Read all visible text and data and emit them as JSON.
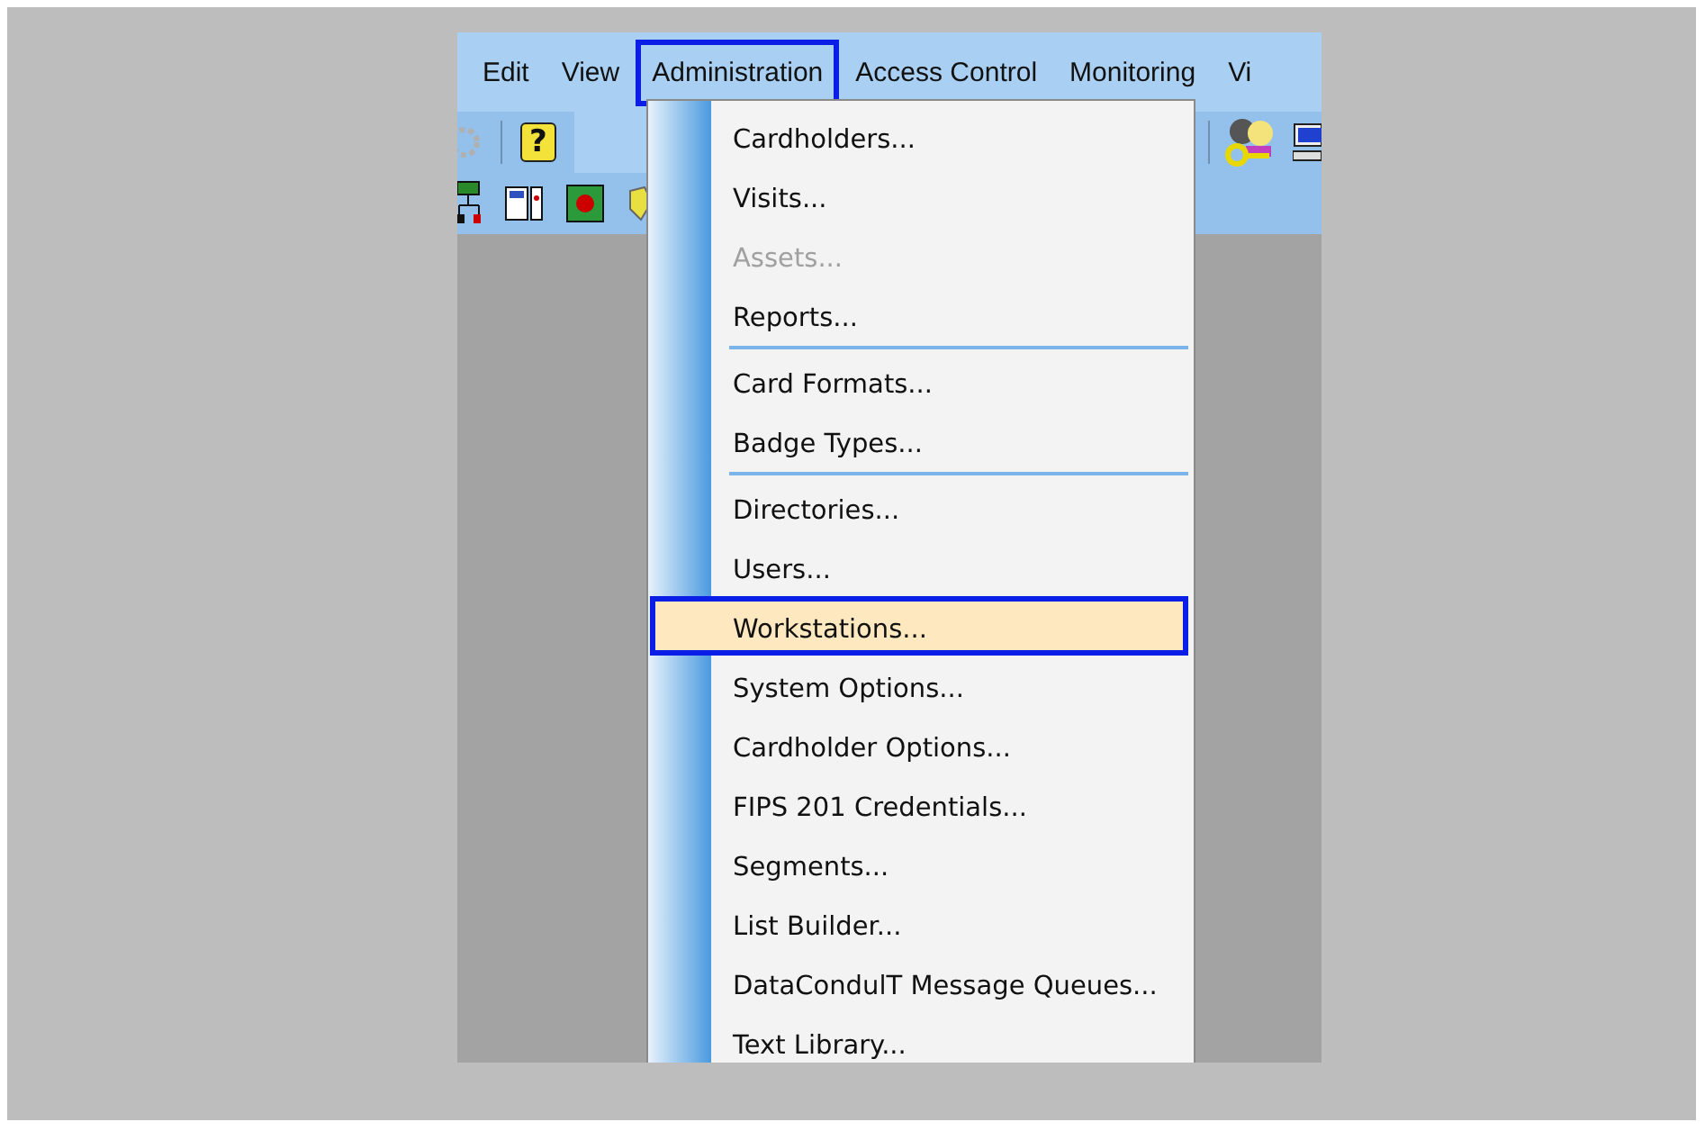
{
  "menu_bar": [
    {
      "label": "Edit",
      "selected": false
    },
    {
      "label": "View",
      "selected": false
    },
    {
      "label": "Administration",
      "selected": true
    },
    {
      "label": "Access Control",
      "selected": false
    },
    {
      "label": "Monitoring",
      "selected": false
    },
    {
      "label": "Vi",
      "selected": false
    }
  ],
  "administration_menu": [
    {
      "label": "Cardholders...",
      "disabled": false,
      "selected": false,
      "separator_after": false
    },
    {
      "label": "Visits...",
      "disabled": false,
      "selected": false,
      "separator_after": false
    },
    {
      "label": "Assets...",
      "disabled": true,
      "selected": false,
      "separator_after": false
    },
    {
      "label": "Reports...",
      "disabled": false,
      "selected": false,
      "separator_after": true
    },
    {
      "label": "Card Formats...",
      "disabled": false,
      "selected": false,
      "separator_after": false
    },
    {
      "label": "Badge Types...",
      "disabled": false,
      "selected": false,
      "separator_after": true
    },
    {
      "label": "Directories...",
      "disabled": false,
      "selected": false,
      "separator_after": false
    },
    {
      "label": "Users...",
      "disabled": false,
      "selected": false,
      "separator_after": false
    },
    {
      "label": "Workstations...",
      "disabled": false,
      "selected": true,
      "separator_after": false
    },
    {
      "label": "System Options...",
      "disabled": false,
      "selected": false,
      "separator_after": false
    },
    {
      "label": "Cardholder Options...",
      "disabled": false,
      "selected": false,
      "separator_after": false
    },
    {
      "label": "FIPS 201 Credentials...",
      "disabled": false,
      "selected": false,
      "separator_after": false
    },
    {
      "label": "Segments...",
      "disabled": false,
      "selected": false,
      "separator_after": false
    },
    {
      "label": "List Builder...",
      "disabled": false,
      "selected": false,
      "separator_after": false
    },
    {
      "label": "DataCondulT Message Queues...",
      "disabled": false,
      "selected": false,
      "separator_after": false
    },
    {
      "label": "Text Library...",
      "disabled": false,
      "selected": false,
      "separator_after": false
    }
  ],
  "toolbar": {
    "help_icon": "?"
  }
}
